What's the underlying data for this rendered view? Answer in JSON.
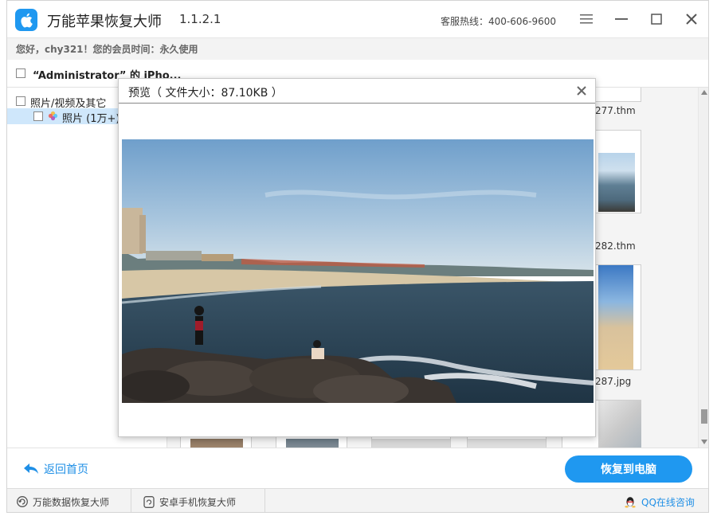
{
  "app": {
    "title": "万能苹果恢复大师",
    "version": "1.1.2.1",
    "hotline": "客服热线：400-606-9600"
  },
  "greeting": "您好，chy321！您的会员时间：永久使用",
  "device": {
    "label": "“Administrator” 的 iPho..."
  },
  "tree": {
    "root_label": "照片/视频及其它",
    "child_label": "照片 (1万+)"
  },
  "thumbnails": {
    "names": [
      "277.thm",
      "282.thm",
      "287.jpg"
    ]
  },
  "dialog": {
    "title": "预览（ 文件大小：87.10KB ）"
  },
  "actions": {
    "back_label": "返回首页",
    "recover_label": "恢复到电脑"
  },
  "status_bar": {
    "data_recovery": "万能数据恢复大师",
    "android_recovery": "安卓手机恢复大师",
    "qq_consult": "QQ在线咨询"
  },
  "colors": {
    "accent": "#1f98f0",
    "link": "#1f8fe6"
  }
}
